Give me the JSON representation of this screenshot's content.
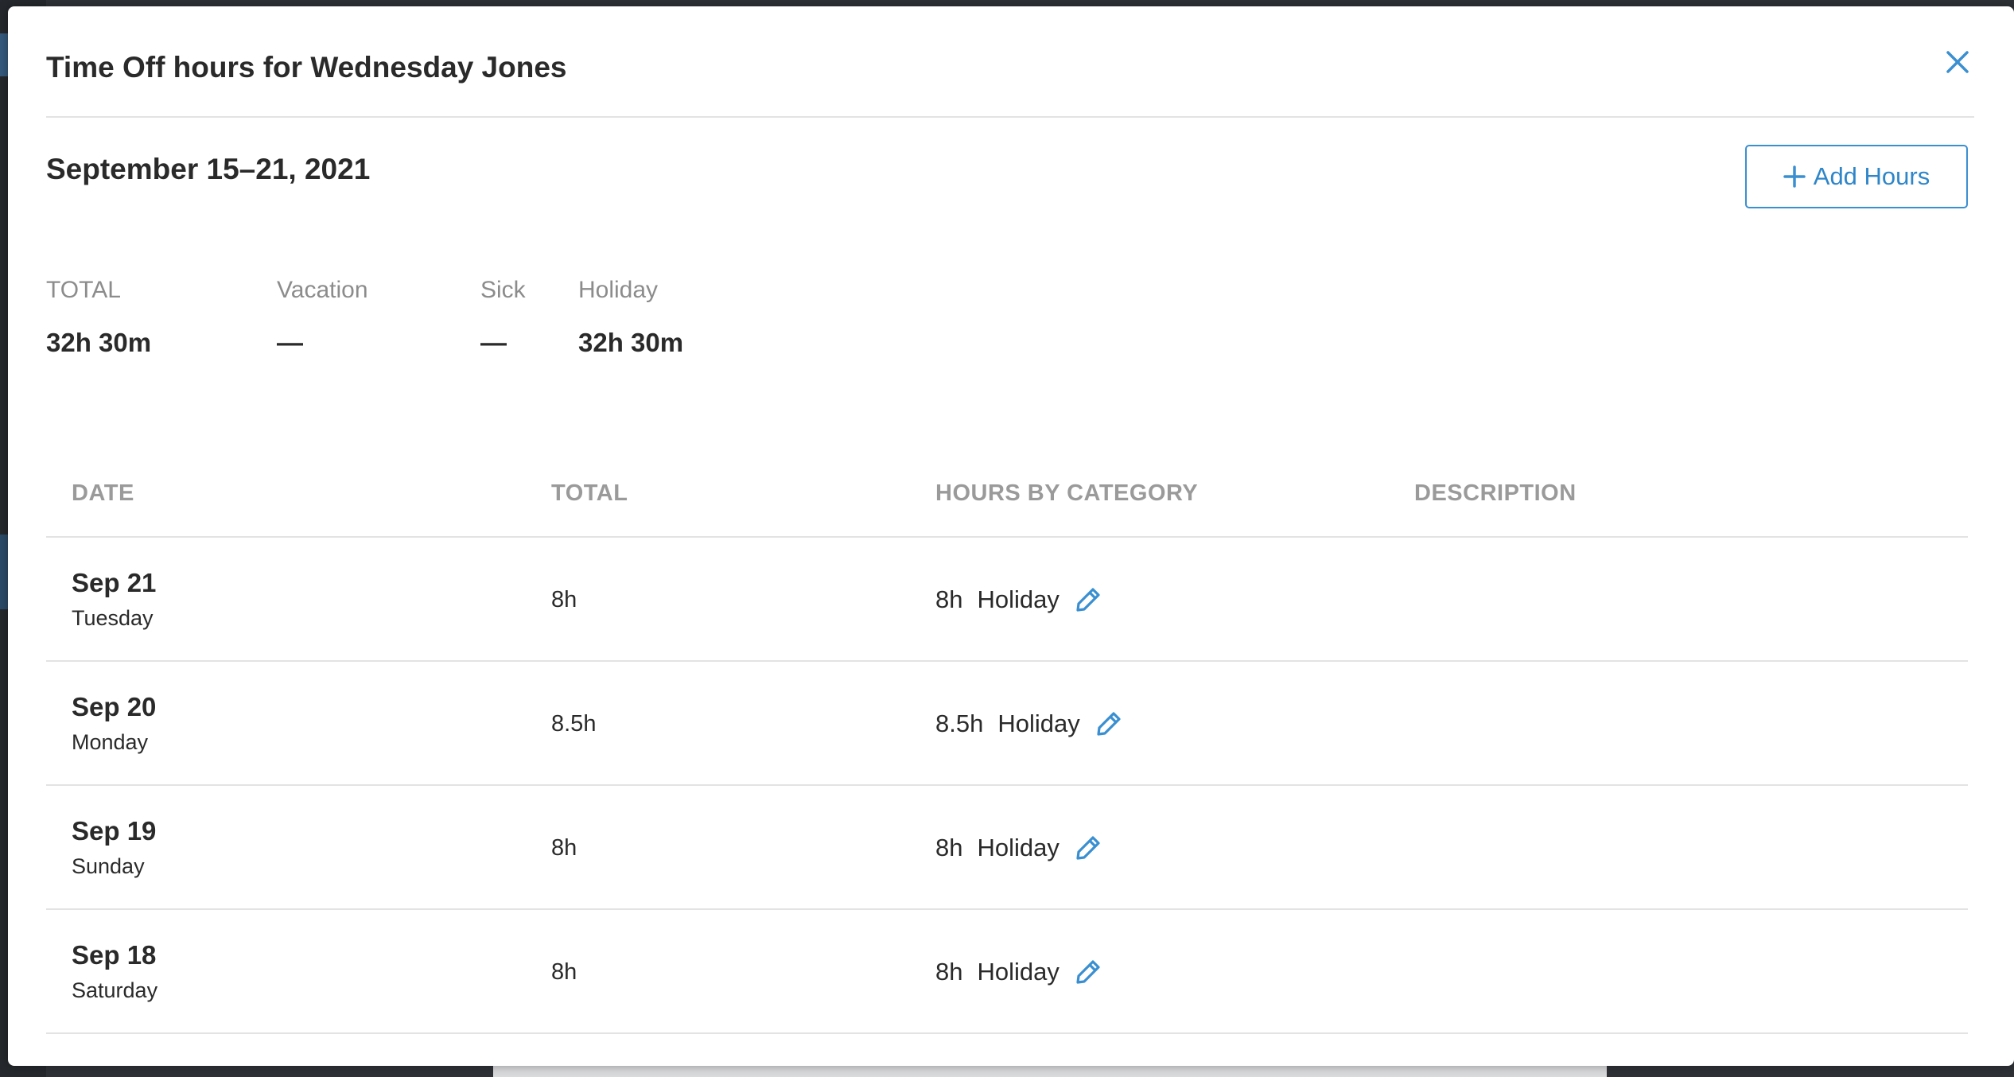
{
  "modal": {
    "title": "Time Off hours for Wednesday Jones",
    "week_range": "September 15–21, 2021",
    "add_button_label": "Add Hours"
  },
  "summary": [
    {
      "label": "TOTAL",
      "value": "32h 30m"
    },
    {
      "label": "Vacation",
      "value": "—"
    },
    {
      "label": "Sick",
      "value": "—"
    },
    {
      "label": "Holiday",
      "value": "32h 30m"
    }
  ],
  "table": {
    "headers": [
      "DATE",
      "TOTAL",
      "HOURS BY CATEGORY",
      "DESCRIPTION"
    ],
    "rows": [
      {
        "date": "Sep 21",
        "weekday": "Tuesday",
        "total": "8h",
        "category_hours": "8h",
        "category": "Holiday",
        "description": ""
      },
      {
        "date": "Sep 20",
        "weekday": "Monday",
        "total": "8.5h",
        "category_hours": "8.5h",
        "category": "Holiday",
        "description": ""
      },
      {
        "date": "Sep 19",
        "weekday": "Sunday",
        "total": "8h",
        "category_hours": "8h",
        "category": "Holiday",
        "description": ""
      },
      {
        "date": "Sep 18",
        "weekday": "Saturday",
        "total": "8h",
        "category_hours": "8h",
        "category": "Holiday",
        "description": ""
      }
    ]
  },
  "icons": {
    "close": "close-icon",
    "add": "plus-icon",
    "edit": "pencil-icon"
  },
  "colors": {
    "accent": "#3a8fd1",
    "text": "#2a2a2a",
    "muted": "#8c8c8c",
    "divider": "#e3e3e3"
  }
}
